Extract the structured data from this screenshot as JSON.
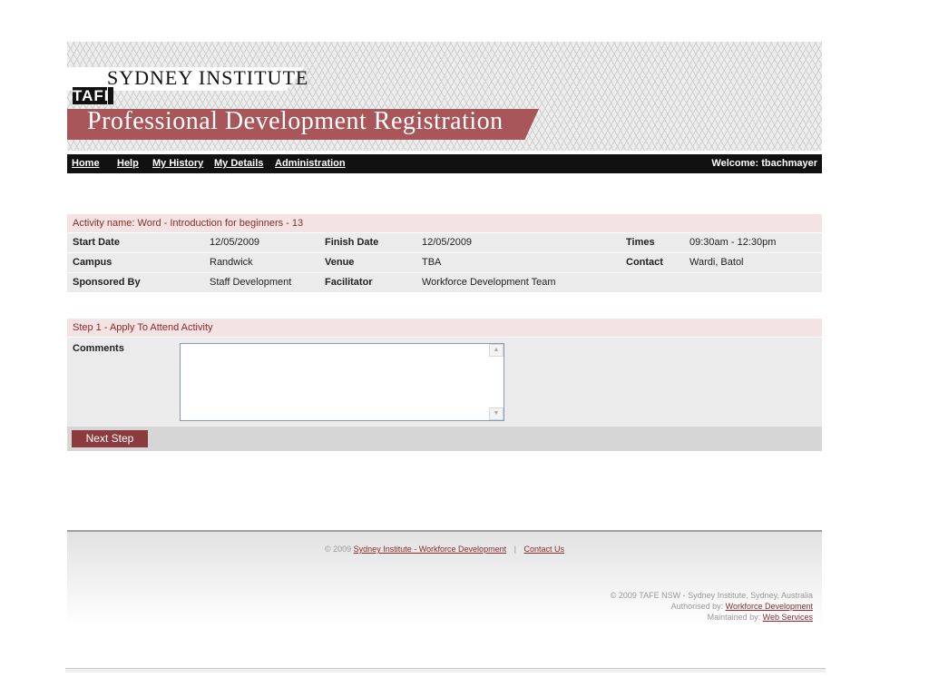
{
  "header": {
    "institute_name": "SYDNEY INSTITUTE",
    "logo_text": "TAFE",
    "app_title": "Professional Development Registration"
  },
  "nav": {
    "items": [
      {
        "label": "Home"
      },
      {
        "label": "Help"
      },
      {
        "label": "My History"
      },
      {
        "label": "My Details"
      },
      {
        "label": "Administration"
      }
    ],
    "welcome": "Welcome: tbachmayer"
  },
  "activity": {
    "heading": "Activity name: Word - Introduction for beginners - 13",
    "rows": [
      [
        {
          "label": "Start Date",
          "value": "12/05/2009"
        },
        {
          "label": "Finish Date",
          "value": "12/05/2009"
        },
        {
          "label": "Times",
          "value": "09:30am - 12:30pm"
        }
      ],
      [
        {
          "label": "Campus",
          "value": "Randwick"
        },
        {
          "label": "Venue",
          "value": "TBA"
        },
        {
          "label": "Contact",
          "value": "Wardi, Batol"
        }
      ],
      [
        {
          "label": "Sponsored By",
          "value": "Staff Development"
        },
        {
          "label": "Facilitator",
          "value": "Workforce Development Team"
        }
      ]
    ]
  },
  "step": {
    "heading": "Step 1 - Apply To Attend Activity",
    "comments_label": "Comments",
    "comments_value": "",
    "next_label": "Next Step"
  },
  "footer": {
    "copyright_prefix": "© 2009",
    "link_workforce": "Sydney Institute - Workforce Development",
    "separator": "|",
    "link_contact": "Contact Us",
    "right_line1": "© 2009 TAFE NSW - Sydney Institute, Sydney, Australia",
    "authorised_prefix": "Authorised by:",
    "authorised_link": "Workforce Development",
    "maintained_prefix": "Maintained by:",
    "maintained_link": "Web Services"
  }
}
